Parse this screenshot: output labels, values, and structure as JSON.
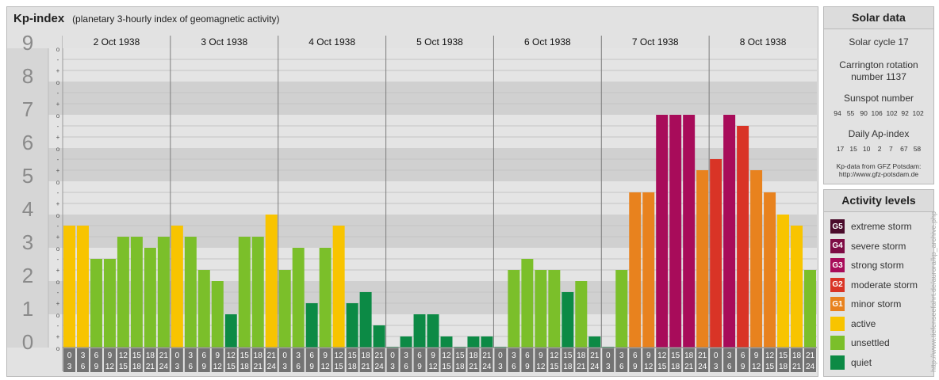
{
  "title": "Kp-index",
  "subtitle": "(planetary 3-hourly index of geomagnetic activity)",
  "chart_data": {
    "type": "bar",
    "ylim": [
      0,
      9
    ],
    "y_ticks": [
      "0",
      "1",
      "2",
      "3",
      "4",
      "5",
      "6",
      "7",
      "8",
      "9"
    ],
    "third_marks": [
      "+",
      "o",
      "-"
    ],
    "days": [
      "2 Oct 1938",
      "3 Oct 1938",
      "4 Oct 1938",
      "5 Oct 1938",
      "6 Oct 1938",
      "7 Oct 1938",
      "8 Oct 1938"
    ],
    "interval_start": [
      "0",
      "3",
      "6",
      "9",
      "12",
      "15",
      "18",
      "21"
    ],
    "interval_end": [
      "3",
      "6",
      "9",
      "12",
      "15",
      "18",
      "21",
      "24"
    ],
    "values": [
      3.667,
      3.667,
      2.667,
      2.667,
      3.333,
      3.333,
      3.0,
      3.333,
      3.667,
      3.333,
      2.333,
      2.0,
      1.0,
      3.333,
      3.333,
      4.0,
      2.333,
      3.0,
      1.333,
      3.0,
      3.667,
      1.333,
      1.667,
      0.667,
      0.0,
      0.333,
      1.0,
      1.0,
      0.333,
      0.0,
      0.333,
      0.333,
      0.0,
      2.333,
      2.667,
      2.333,
      2.333,
      1.667,
      2.0,
      0.333,
      0.0,
      2.333,
      4.667,
      4.667,
      7.0,
      7.0,
      7.0,
      5.333,
      5.667,
      7.0,
      6.667,
      5.333,
      4.667,
      4.0,
      3.667,
      2.333
    ]
  },
  "solar": {
    "heading": "Solar data",
    "cycle": "Solar cycle 17",
    "carrington_line1": "Carrington rotation",
    "carrington_line2": "number 1137",
    "sunspot_label": "Sunspot number",
    "sunspot_values": "94   55   90  106  102  92  102",
    "ap_label": "Daily Ap-index",
    "ap_values": "17   15   10    2    7    67   58",
    "credit_line1": "Kp-data from GFZ Potsdam:",
    "credit_line2": "http://www.gfz-potsdam.de"
  },
  "levels": {
    "heading": "Activity levels",
    "items": [
      {
        "badge": "G5",
        "label": "extreme storm",
        "color": "#4a0b2b"
      },
      {
        "badge": "G4",
        "label": "severe storm",
        "color": "#7e0c45"
      },
      {
        "badge": "G3",
        "label": "strong storm",
        "color": "#a80c5a"
      },
      {
        "badge": "G2",
        "label": "moderate storm",
        "color": "#d93426"
      },
      {
        "badge": "G1",
        "label": "minor storm",
        "color": "#e8821e"
      },
      {
        "badge": "",
        "label": "active",
        "color": "#f8c400"
      },
      {
        "badge": "",
        "label": "unsettled",
        "color": "#7bbf2a"
      },
      {
        "badge": "",
        "label": "quiet",
        "color": "#0c8a45"
      }
    ]
  },
  "watermark": "http://www.tiefenseefahrt.de/aurora/kp_archive.php"
}
